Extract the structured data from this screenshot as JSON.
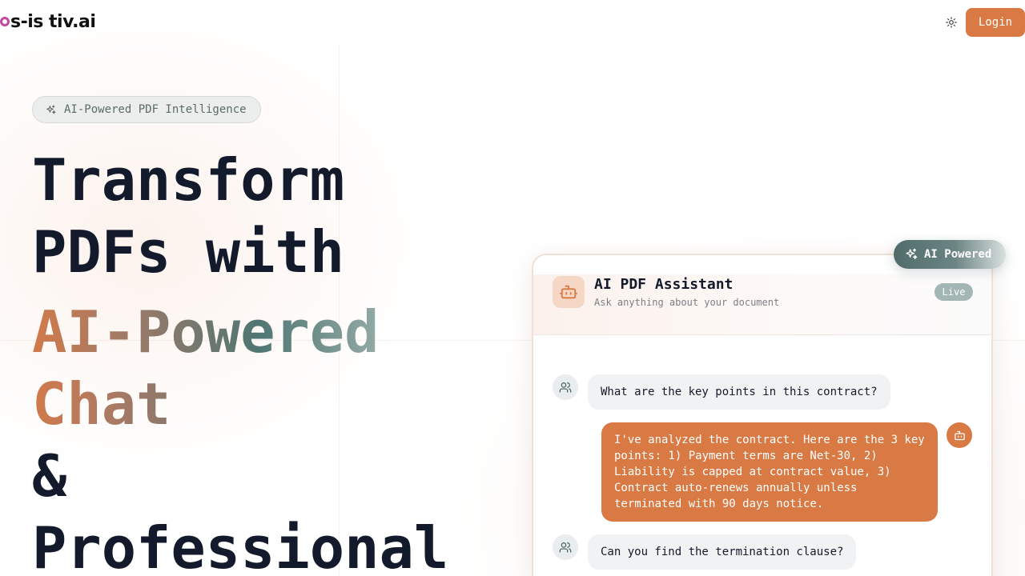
{
  "header": {
    "logo_text": "s-is tiv.ai",
    "login_label": "Login"
  },
  "hero": {
    "badge_label": "AI-Powered PDF Intelligence",
    "line1": "Transform",
    "line2": "PDFs with",
    "line3": "AI-Powered",
    "line4": "Chat",
    "line5": "&",
    "line6": "Professional"
  },
  "floating_badge": {
    "label": "AI Powered"
  },
  "chat": {
    "title": "AI PDF Assistant",
    "subtitle": "Ask anything about your document",
    "status": "Live",
    "messages": [
      {
        "role": "user",
        "text": "What are the key points in this contract?"
      },
      {
        "role": "assistant",
        "text": "I've analyzed the contract. Here are the 3 key points: 1) Payment terms are Net-30, 2) Liability is capped at contract value, 3) Contract auto-renews annually unless terminated with 90 days notice."
      },
      {
        "role": "user",
        "text": "Can you find the termination clause?"
      }
    ]
  },
  "colors": {
    "accent": "#d97a44",
    "teal": "#4f7672",
    "heading": "#131a2b"
  }
}
